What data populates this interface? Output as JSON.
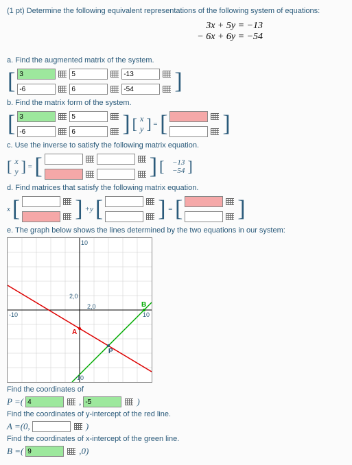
{
  "header": "(1 pt) Determine the following equivalent representations of the following system of equations:",
  "eq1": "3x + 5y = −13",
  "eq2": "− 6x + 6y = −54",
  "a": {
    "t": "a. Find the augmented matrix of the system.",
    "v11": "3",
    "v12": "5",
    "v13": "-13",
    "v21": "-6",
    "v22": "6",
    "v23": "-54"
  },
  "b": {
    "t": "b. Find the matrix form of the system.",
    "v11": "3",
    "v12": "5",
    "v21": "-6",
    "v22": "6",
    "x": "x",
    "y": "y"
  },
  "c": {
    "t": "c. Use the inverse to satisfy the following matrix equation.",
    "x": "x",
    "y": "y",
    "r1": "−13",
    "r2": "−54"
  },
  "d": {
    "t": "d. Find matrices that satisfy the following matrix equation.",
    "x": "x",
    "py": "+y",
    "eq": "="
  },
  "e": {
    "t": "e. The graph below shows the lines determined by the two equations in our system:"
  },
  "chart_data": {
    "type": "line",
    "xlim": [
      -10,
      10
    ],
    "ylim": [
      -10,
      10
    ],
    "title": "",
    "xlabel": "",
    "ylabel": "",
    "grid": true,
    "series": [
      {
        "name": "red line (3x+5y=-13)",
        "points": [
          [
            -10,
            3.4
          ],
          [
            10,
            -8.6
          ]
        ],
        "color": "#d00"
      },
      {
        "name": "green line (-6x+6y=-54)",
        "points": [
          [
            -1,
            -10
          ],
          [
            10,
            1
          ]
        ],
        "color": "#0a0"
      }
    ],
    "annotations": [
      {
        "label": "2,0",
        "xy": [
          0,
          2
        ]
      },
      {
        "label": "2,0",
        "xy": [
          2,
          0
        ]
      },
      {
        "label": "A",
        "xy": [
          0,
          -2.6
        ]
      },
      {
        "label": "P",
        "xy": [
          4,
          -5
        ]
      },
      {
        "label": "B",
        "xy": [
          9,
          0
        ]
      }
    ],
    "ticks": [
      "-10",
      "-10",
      "10",
      "10"
    ]
  },
  "f": {
    "find": "Find the coordinates of",
    "P": "P =(",
    "p1": "4",
    "p2": "-5",
    "close": ")",
    "redline": "Find the coordinates of y-intercept of the red line.",
    "A": "A =(0,",
    "greenline": "Find the coordinates of x-intercept of the green line.",
    "B": "B =(",
    "b1": "9",
    "bend": ",0)"
  }
}
